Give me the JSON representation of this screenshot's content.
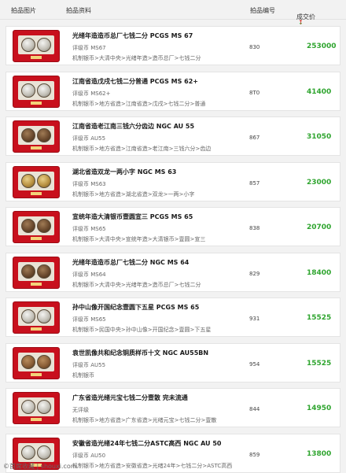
{
  "header": {
    "col_image": "拍品图片",
    "col_info": "拍品资料",
    "col_lot": "拍品编号",
    "col_price": "成交价",
    "arrow_down": "↓",
    "arrow_up": "↑"
  },
  "items": [
    {
      "title": "光绪年造造币总厂七钱二分 PCGS MS 67",
      "grade": "评级币 MS67",
      "category": "机制银币>大清中央>光绪年造>造币总厂>七钱二分",
      "lot": "830",
      "price": "253000",
      "coin_tone": "silver"
    },
    {
      "title": "江南省造戊戌七钱二分普通 PCGS MS 62+",
      "grade": "评级币 MS62+",
      "category": "机制银币>地方省造>江南省造>戊戌>七钱二分>普通",
      "lot": "8T0",
      "price": "41400",
      "coin_tone": "silver"
    },
    {
      "title": "江南省造老江南三钱六分齿边 NGC AU 55",
      "grade": "评级币 AU55",
      "category": "机制银币>地方省造>江南省造>老江南>三钱六分>齿边",
      "lot": "867",
      "price": "31050",
      "coin_tone": "dark"
    },
    {
      "title": "湖北省造双龙一两小字 NGC MS 63",
      "grade": "评级币 MS63",
      "category": "机制银币>地方省造>湖北省造>双龙>一两>小字",
      "lot": "857",
      "price": "23000",
      "coin_tone": "gold"
    },
    {
      "title": "宣统年造大清银币壹圆宣三 PCGS MS 65",
      "grade": "评级币 MS65",
      "category": "机制银币>大清中央>宣统年造>大清银币>壹圆>宣三",
      "lot": "838",
      "price": "20700",
      "coin_tone": "dark"
    },
    {
      "title": "光绪年造造币总厂七钱二分 NGC MS 64",
      "grade": "评级币 MS64",
      "category": "机制银币>大清中央>光绪年造>造币总厂>七钱二分",
      "lot": "829",
      "price": "18400",
      "coin_tone": "dark"
    },
    {
      "title": "孙中山像开国纪念壹圆下五星 PCGS MS 65",
      "grade": "评级币 MS65",
      "category": "机制银币>民国中央>孙中山像>开国纪念>壹圆>下五星",
      "lot": "931",
      "price": "15525",
      "coin_tone": "silver"
    },
    {
      "title": "袁世凯像共和纪念铜质样币十文 NGC AU55BN",
      "grade": "评级币 AU55",
      "category": "机制银币",
      "lot": "954",
      "price": "15525",
      "coin_tone": "brown"
    },
    {
      "title": "广东省造光绪元宝七钱二分壹散 完未流通",
      "grade": "无评级",
      "category": "机制银币>地方省造>广东省造>光绪元宝>七钱二分>壹散",
      "lot": "844",
      "price": "14950",
      "coin_tone": "silver"
    },
    {
      "title": "安徽省造光绪24年七钱二分ASTC高西 NGC AU 50",
      "grade": "评级币 AU50",
      "category": "机制银币>地方省造>安徽省造>光绪24年>七钱二分>ASTC高西",
      "lot": "859",
      "price": "13800",
      "coin_tone": "silver"
    }
  ],
  "footer": {
    "watermark": "©首席收藏 | shouxi.com"
  }
}
